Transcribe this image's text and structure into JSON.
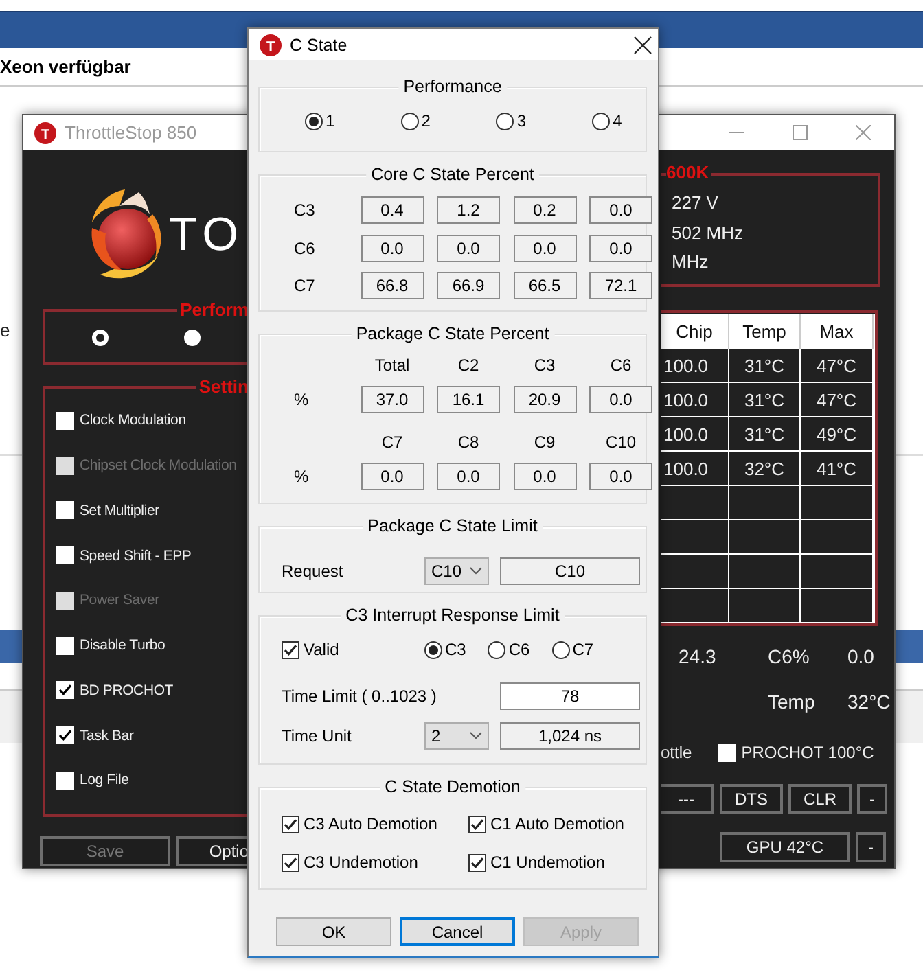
{
  "background_page": {
    "heading": "Xeon verfügbar",
    "fragment": "e"
  },
  "throttlestop": {
    "title": "ThrottleStop 850",
    "icon_letter": "T",
    "logo_text": "TO",
    "performance": {
      "label": "Perform",
      "radios": [
        {
          "selected": true
        },
        {
          "selected": false
        }
      ]
    },
    "settings": {
      "label": "Settin",
      "options": [
        {
          "label": "Clock Modulation",
          "checked": false,
          "disabled": false
        },
        {
          "label": "Chipset Clock Modulation",
          "checked": false,
          "disabled": true
        },
        {
          "label": "Set Multiplier",
          "checked": false,
          "disabled": false
        },
        {
          "label": "Speed Shift - EPP",
          "checked": false,
          "disabled": false
        },
        {
          "label": "Power Saver",
          "checked": false,
          "disabled": true
        },
        {
          "label": "Disable Turbo",
          "checked": false,
          "disabled": false
        },
        {
          "label": "BD PROCHOT",
          "checked": true,
          "disabled": false
        },
        {
          "label": "Task Bar",
          "checked": true,
          "disabled": false
        },
        {
          "label": "Log File",
          "checked": false,
          "disabled": false
        }
      ]
    },
    "buttons": [
      {
        "label": "Save",
        "disabled": true
      },
      {
        "label": "Optio",
        "disabled": false
      }
    ],
    "cpu_box": {
      "label": "600K",
      "lines": [
        "227 V",
        "502 MHz",
        "MHz"
      ]
    },
    "table": {
      "columns": [
        "Chip",
        "Temp",
        "Max"
      ],
      "rows": [
        [
          "100.0",
          "31°C",
          "47°C"
        ],
        [
          "100.0",
          "31°C",
          "47°C"
        ],
        [
          "100.0",
          "31°C",
          "49°C"
        ],
        [
          "100.0",
          "32°C",
          "41°C"
        ]
      ]
    },
    "stats": [
      {
        "value": "24.3",
        "label": "C6%",
        "reading": "0.0"
      },
      {
        "label": "Temp",
        "reading": "32°C"
      }
    ],
    "prochot": {
      "prefix": "ottle",
      "label": "PROCHOT 100°C",
      "checked": false
    },
    "button_rows": [
      [
        "---",
        "DTS",
        "CLR",
        "-"
      ],
      [
        "GPU 42°C",
        "-"
      ]
    ]
  },
  "c_state": {
    "title": "C State",
    "icon_letter": "T",
    "performance": {
      "title": "Performance",
      "options": [
        {
          "label": "1",
          "selected": true
        },
        {
          "label": "2",
          "selected": false
        },
        {
          "label": "3",
          "selected": false
        },
        {
          "label": "4",
          "selected": false
        }
      ]
    },
    "core": {
      "title": "Core C State Percent",
      "rows": [
        {
          "label": "C3",
          "values": [
            "0.4",
            "1.2",
            "0.2",
            "0.0"
          ]
        },
        {
          "label": "C6",
          "values": [
            "0.0",
            "0.0",
            "0.0",
            "0.0"
          ]
        },
        {
          "label": "C7",
          "values": [
            "66.8",
            "66.9",
            "66.5",
            "72.1"
          ]
        }
      ]
    },
    "package": {
      "title": "Package C State Percent",
      "blocks": [
        {
          "columns": [
            "Total",
            "C2",
            "C3",
            "C6"
          ],
          "row_label": "%",
          "values": [
            "37.0",
            "16.1",
            "20.9",
            "0.0"
          ]
        },
        {
          "columns": [
            "C7",
            "C8",
            "C9",
            "C10"
          ],
          "row_label": "%",
          "values": [
            "0.0",
            "0.0",
            "0.0",
            "0.0"
          ]
        }
      ]
    },
    "limit": {
      "title": "Package C State Limit",
      "label": "Request",
      "dropdown": "C10",
      "value": "C10"
    },
    "interrupt": {
      "title": "C3 Interrupt Response Limit",
      "valid": {
        "label": "Valid",
        "checked": true
      },
      "states": [
        {
          "label": "C3",
          "selected": true
        },
        {
          "label": "C6",
          "selected": false
        },
        {
          "label": "C7",
          "selected": false
        }
      ],
      "time_limit": {
        "label": "Time Limit ( 0..1023 )",
        "value": "78"
      },
      "time_unit": {
        "label": "Time Unit",
        "dropdown": "2",
        "value": "1,024 ns"
      }
    },
    "demotion": {
      "title": "C State Demotion",
      "options": [
        {
          "label": "C3 Auto Demotion",
          "checked": true
        },
        {
          "label": "C1 Auto Demotion",
          "checked": true
        },
        {
          "label": "C3 Undemotion",
          "checked": true
        },
        {
          "label": "C1 Undemotion",
          "checked": true
        }
      ]
    },
    "buttons": [
      {
        "label": "OK",
        "disabled": false,
        "focused": false
      },
      {
        "label": "Cancel",
        "disabled": false,
        "focused": true
      },
      {
        "label": "Apply",
        "disabled": true,
        "focused": false
      }
    ]
  }
}
